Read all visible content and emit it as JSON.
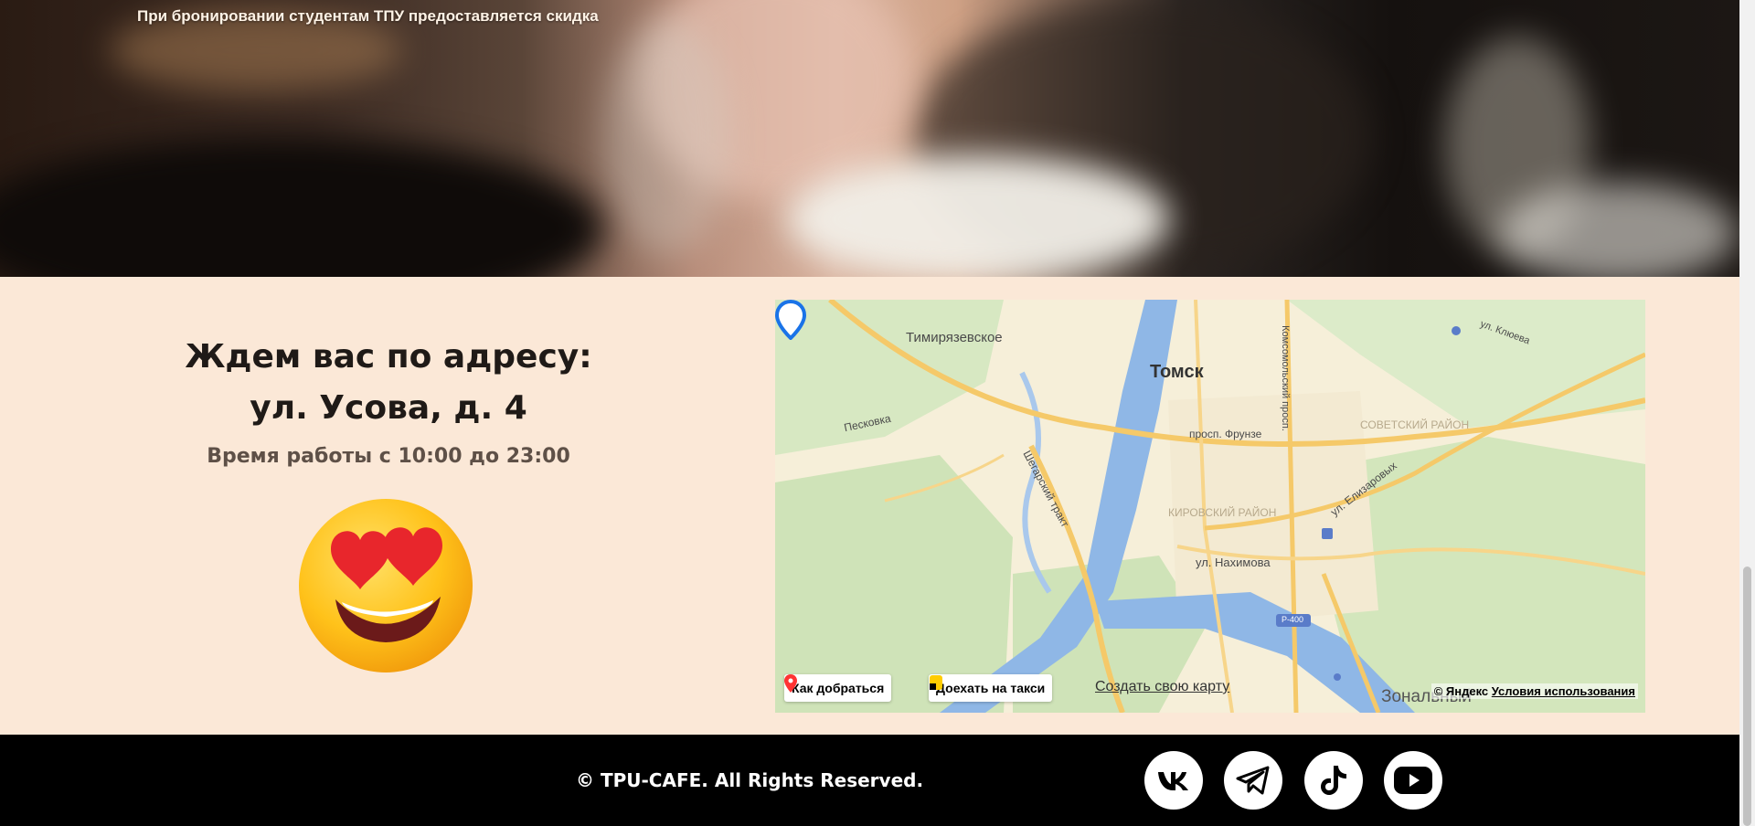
{
  "hero": {
    "note": "При бронировании студентам ТПУ предоставляется скидка"
  },
  "contacts": {
    "heading_line1": "Ждем вас по адресу:",
    "heading_line2": "ул. Усова, д. 4",
    "hours": "Время работы с 10:00 до 23:00"
  },
  "map": {
    "city": "Томск",
    "labels": {
      "timiryazevskoe": "Тимирязевское",
      "frunze": "просп. Фрунзе",
      "kirovsky": "КИРОВСКИЙ РАЙОН",
      "sovetsky": "СОВЕТСКИЙ РАЙОН",
      "elizarovykh": "ул. Елизаровых",
      "nakhimova": "ул. Нахимова",
      "shegarsky": "Шегарский тракт",
      "komsomolsky": "Комсомольский просп.",
      "zonalny": "Зональный",
      "peskovka": "Песковка",
      "klyueva": "ул. Клюева",
      "road_sign": "Р-400"
    },
    "route_button": "Как добраться",
    "taxi_button": "Доехать на такси",
    "create_map_link": "Создать свою карту",
    "copyright_brand": "© Яндекс",
    "terms_link": "Условия использования",
    "colors": {
      "water": "#8fb7e6",
      "green": "#cfe3b8",
      "road": "#f5c969",
      "pin": "#1a73e8"
    }
  },
  "footer": {
    "copyright": "© TPU-CAFE. All Rights Reserved.",
    "social": [
      {
        "name": "vk-icon"
      },
      {
        "name": "telegram-icon"
      },
      {
        "name": "tiktok-icon"
      },
      {
        "name": "youtube-icon"
      }
    ]
  }
}
